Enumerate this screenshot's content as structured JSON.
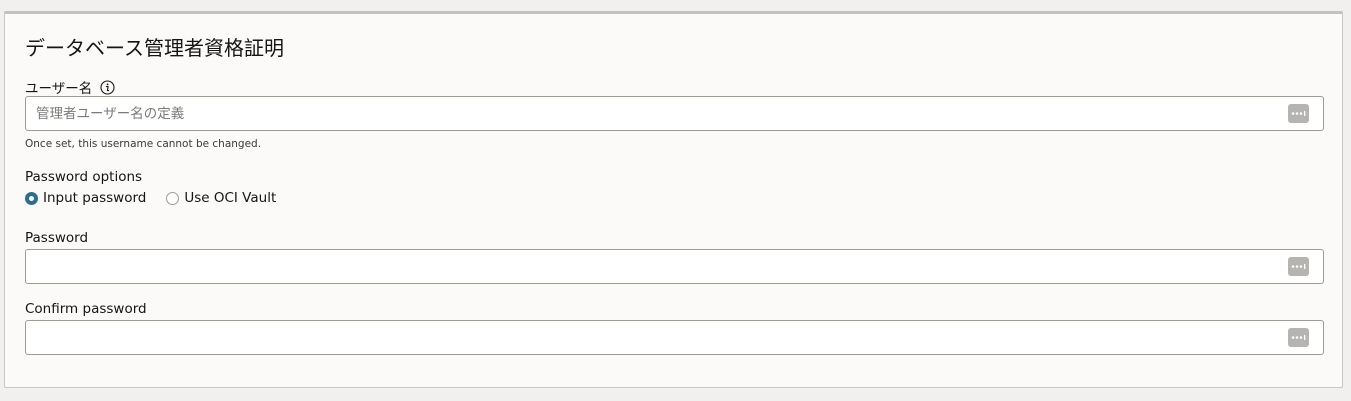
{
  "section": {
    "title": "データベース管理者資格証明"
  },
  "username": {
    "label": "ユーザー名",
    "placeholder": "管理者ユーザー名の定義",
    "value": "",
    "help_text": "Once set, this username cannot be changed."
  },
  "password_options": {
    "label": "Password options",
    "options": [
      {
        "label": "Input password",
        "selected": true
      },
      {
        "label": "Use OCI Vault",
        "selected": false
      }
    ]
  },
  "password": {
    "label": "Password",
    "value": ""
  },
  "confirm_password": {
    "label": "Confirm password",
    "value": ""
  },
  "colors": {
    "accent": "#2d6e8e",
    "border": "#9e9a95",
    "panel_bg": "#fbfaf8",
    "keypad_icon": "#b6b4b1"
  },
  "icons": {
    "info": "info-icon",
    "password_manager": "password-keypad-icon"
  }
}
